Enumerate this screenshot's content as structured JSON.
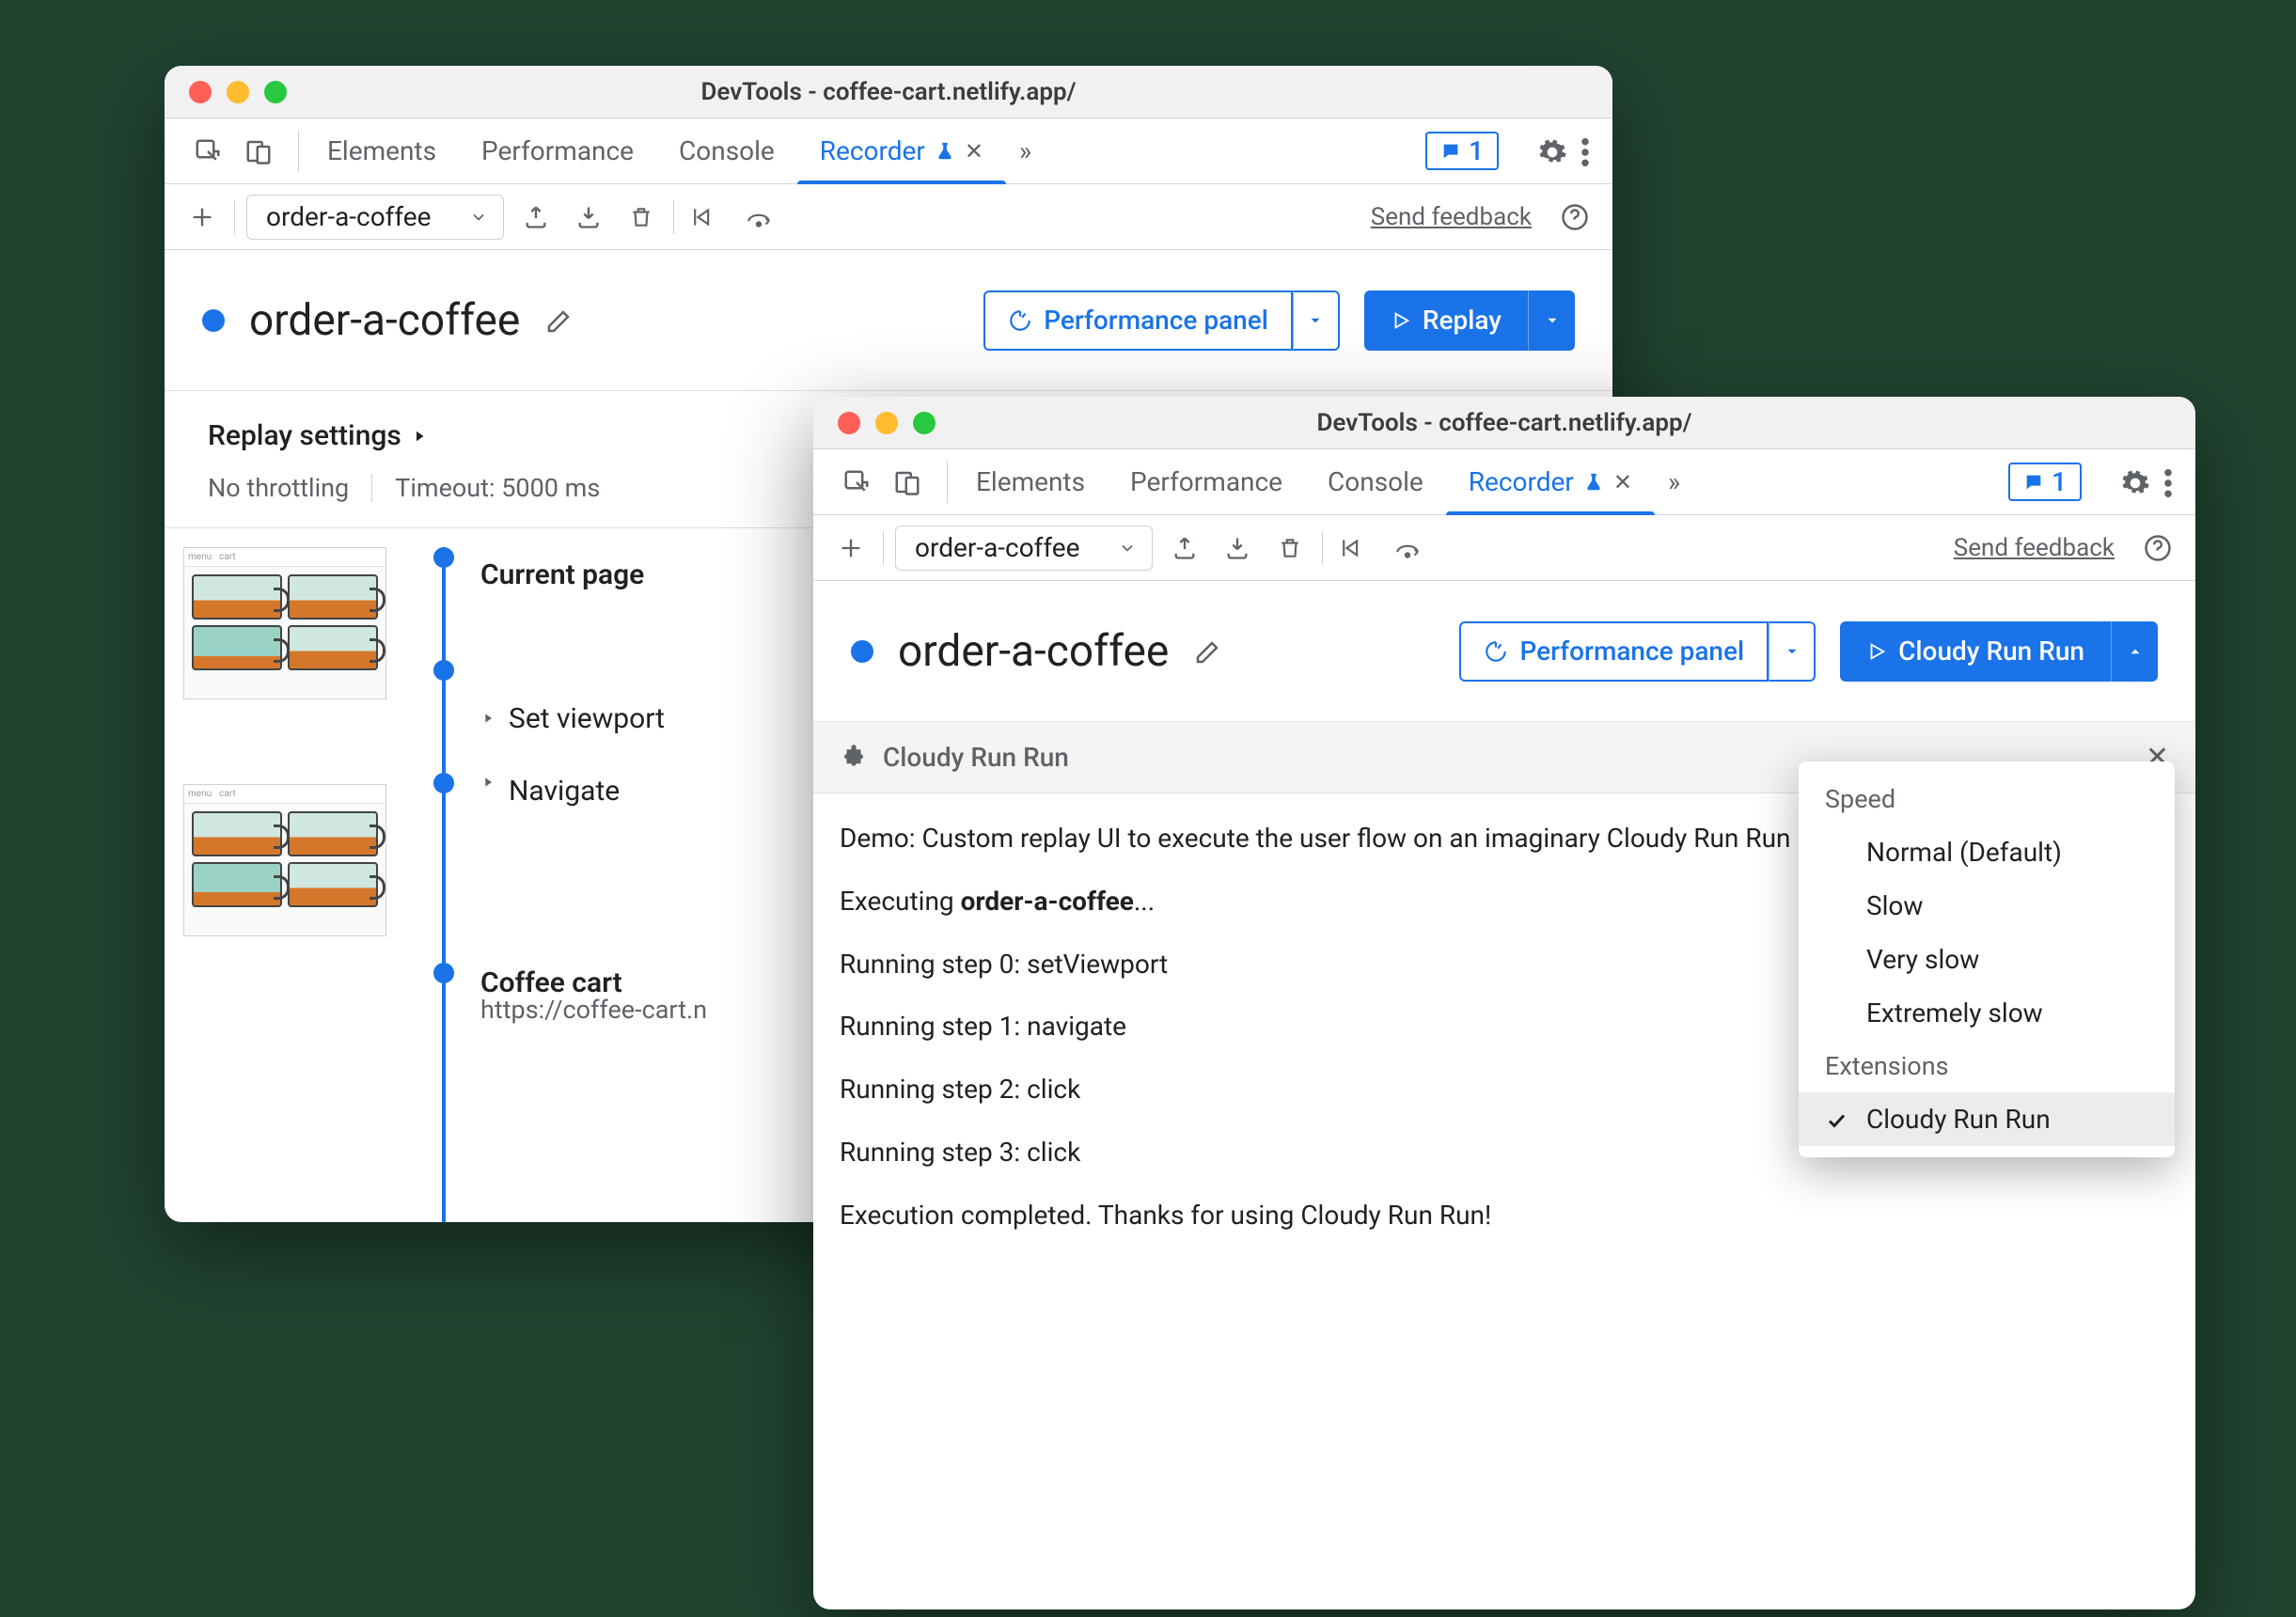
{
  "window1": {
    "title": "DevTools - coffee-cart.netlify.app/",
    "tabs": [
      "Elements",
      "Performance",
      "Console",
      "Recorder"
    ],
    "activeTab": "Recorder",
    "moreTabs": "»",
    "issuesCount": "1",
    "toolbar": {
      "recordingName": "order-a-coffee",
      "feedback": "Send feedback"
    },
    "recording": {
      "name": "order-a-coffee",
      "perfButton": "Performance panel",
      "replayButton": "Replay"
    },
    "settings": {
      "title": "Replay settings",
      "throttle": "No throttling",
      "timeout": "Timeout: 5000 ms"
    },
    "steps": {
      "current": "Current page",
      "setViewport": "Set viewport",
      "navigate": "Navigate",
      "groupTitle": "Coffee cart",
      "groupUrl": "https://coffee-cart.n"
    }
  },
  "window2": {
    "title": "DevTools - coffee-cart.netlify.app/",
    "tabs": [
      "Elements",
      "Performance",
      "Console",
      "Recorder"
    ],
    "activeTab": "Recorder",
    "moreTabs": "»",
    "issuesCount": "1",
    "toolbar": {
      "recordingName": "order-a-coffee",
      "feedback": "Send feedback"
    },
    "recording": {
      "name": "order-a-coffee",
      "perfButton": "Performance panel",
      "replayButton": "Cloudy Run Run"
    },
    "panel": {
      "title": "Cloudy Run Run",
      "demo": "Demo: Custom replay UI to execute the user flow on an imaginary Cloudy Run Run platform.",
      "exec_prefix": "Executing ",
      "exec_name": "order-a-coffee",
      "exec_suffix": "...",
      "s0": "Running step 0: setViewport",
      "s1": "Running step 1: navigate",
      "s2": "Running step 2: click",
      "s3": "Running step 3: click",
      "done": "Execution completed. Thanks for using Cloudy Run Run!"
    },
    "menu": {
      "speedLabel": "Speed",
      "items": [
        "Normal (Default)",
        "Slow",
        "Very slow",
        "Extremely slow"
      ],
      "extLabel": "Extensions",
      "extItem": "Cloudy Run Run"
    }
  }
}
